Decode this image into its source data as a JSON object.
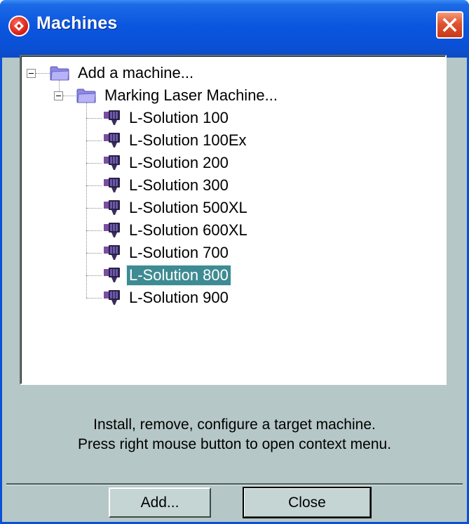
{
  "window": {
    "title": "Machines"
  },
  "tree": {
    "root": {
      "label": "Add a machine...",
      "child": {
        "label": "Marking Laser Machine...",
        "items": [
          "L-Solution 100",
          "L-Solution 100Ex",
          "L-Solution 200",
          "L-Solution 300",
          "L-Solution 500XL",
          "L-Solution 600XL",
          "L-Solution 700",
          "L-Solution 800",
          "L-Solution 900"
        ],
        "selected_index": 7
      }
    }
  },
  "info": {
    "line1": "Install, remove, configure a target machine.",
    "line2": "Press right mouse button to open context menu."
  },
  "buttons": {
    "add": "Add...",
    "close": "Close"
  },
  "colors": {
    "titlebar": "#0b56df",
    "dialog_bg": "#b5c7c6",
    "selection": "#3e8b93"
  },
  "icons": {
    "app": "app-logo-icon",
    "close": "close-icon",
    "folder": "folder-icon",
    "machine": "laser-machine-icon",
    "expander": "collapse-minus-icon"
  }
}
